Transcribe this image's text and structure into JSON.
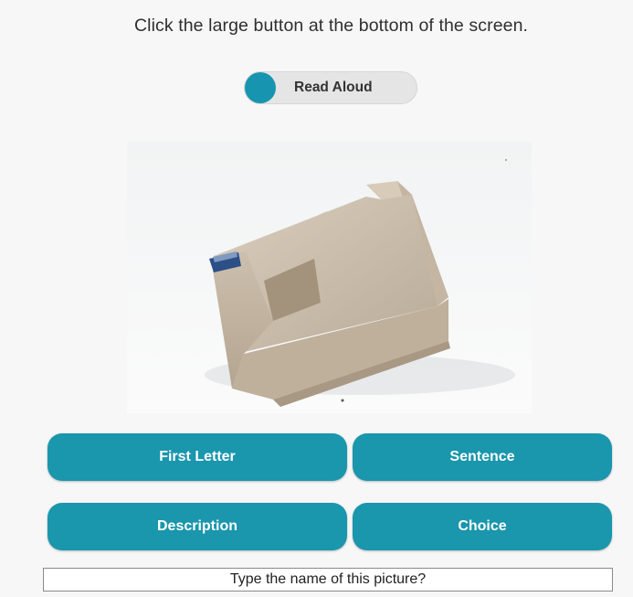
{
  "instruction": "Click the large button at the bottom of the screen.",
  "read_aloud": {
    "label": "Read Aloud",
    "accent_color": "#1795b0"
  },
  "picture": {
    "subject": "tape-dispenser"
  },
  "hint_buttons": {
    "first_letter": "First Letter",
    "sentence": "Sentence",
    "description": "Description",
    "choice": "Choice",
    "color": "#1a96ad"
  },
  "answer": {
    "prompt": "Type the name of this picture?"
  }
}
